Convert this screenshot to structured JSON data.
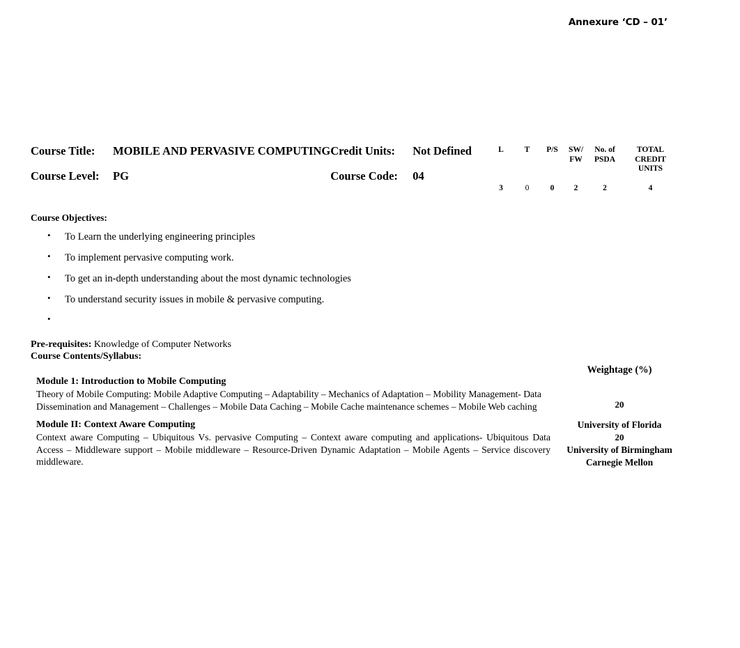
{
  "document": {
    "annexure_label": "Annexure ‘CD – 01’"
  },
  "course_header": {
    "course_title_label": "Course Title:",
    "course_title_value": "MOBILE AND PERVASIVE COMPUTING",
    "credit_units_label": "Credit Units:",
    "credit_units_value": "Not Defined",
    "course_level_label": "Course Level:",
    "course_level_value": "PG",
    "course_code_label": "Course Code:",
    "course_code_value": "04"
  },
  "credits_table": {
    "headers": [
      "L",
      "T",
      "P/S",
      "SW/ FW",
      "No. of PSDA",
      "TOTAL CREDIT UNITS"
    ],
    "header_lines": {
      "l": "L",
      "t": "T",
      "ps": "P/S",
      "sw_line1": "SW/",
      "sw_line2": "FW",
      "psda_line1": "No. of",
      "psda_line2": "PSDA",
      "total_line1": "TOTAL",
      "total_line2": "CREDIT",
      "total_line3": "UNITS"
    },
    "values": {
      "l": "3",
      "t": "0",
      "ps": "0",
      "sw": "2",
      "psda": "2",
      "total": "4"
    }
  },
  "objectives": {
    "title": "Course Objectives:",
    "items": [
      "To Learn the underlying engineering principles",
      "To implement pervasive computing work.",
      "To get an in-depth understanding about the most dynamic technologies",
      "To understand security issues in mobile & pervasive computing.",
      ""
    ]
  },
  "prerequisites": {
    "label": "Pre-requisites:",
    "value": "Knowledge of Computer Networks"
  },
  "contents": {
    "title": "Course Contents/Syllabus:",
    "weightage_header": "Weightage (%)",
    "modules": [
      {
        "heading": "Module 1: Introduction to Mobile Computing",
        "body": "Theory of Mobile Computing: Mobile Adaptive Computing – Adaptability – Mechanics of Adaptation – Mobility Management- Data Dissemination and Management – Challenges – Mobile Data Caching – Mobile Cache maintenance schemes – Mobile Web caching",
        "weightage": "20"
      },
      {
        "heading": "Module II: Context Aware Computing",
        "body": "Context aware Computing – Ubiquitous Vs. pervasive Computing – Context aware computing and applications- Ubiquitous Data Access – Middleware support – Mobile middleware – Resource-Driven Dynamic Adaptation – Mobile Agents – Service discovery middleware.",
        "weightage": "20"
      }
    ],
    "reference_notes": [
      "University of Florida",
      "University of Birmingham",
      "Carnegie Mellon"
    ]
  }
}
